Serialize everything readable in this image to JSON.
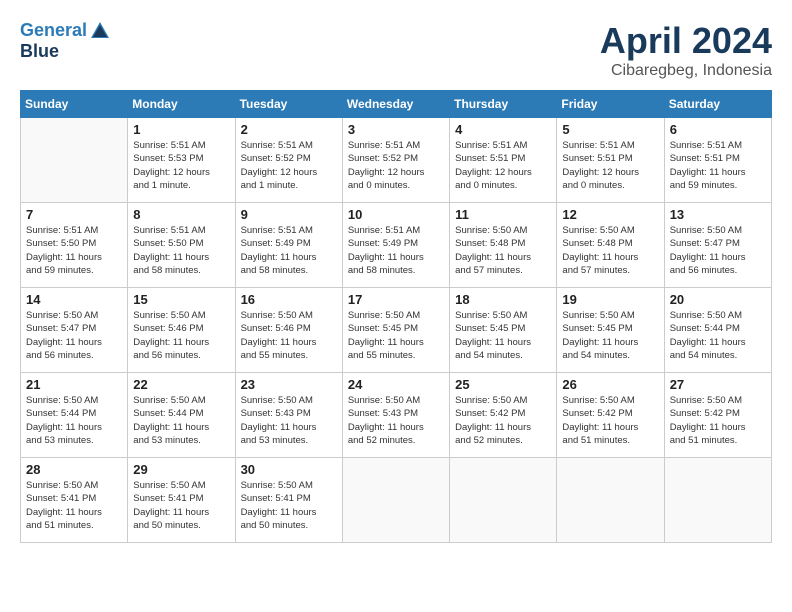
{
  "header": {
    "logo_line1": "General",
    "logo_line2": "Blue",
    "month_title": "April 2024",
    "subtitle": "Cibaregbeg, Indonesia"
  },
  "days_of_week": [
    "Sunday",
    "Monday",
    "Tuesday",
    "Wednesday",
    "Thursday",
    "Friday",
    "Saturday"
  ],
  "weeks": [
    [
      {
        "day": "",
        "info": ""
      },
      {
        "day": "1",
        "info": "Sunrise: 5:51 AM\nSunset: 5:53 PM\nDaylight: 12 hours\nand 1 minute."
      },
      {
        "day": "2",
        "info": "Sunrise: 5:51 AM\nSunset: 5:52 PM\nDaylight: 12 hours\nand 1 minute."
      },
      {
        "day": "3",
        "info": "Sunrise: 5:51 AM\nSunset: 5:52 PM\nDaylight: 12 hours\nand 0 minutes."
      },
      {
        "day": "4",
        "info": "Sunrise: 5:51 AM\nSunset: 5:51 PM\nDaylight: 12 hours\nand 0 minutes."
      },
      {
        "day": "5",
        "info": "Sunrise: 5:51 AM\nSunset: 5:51 PM\nDaylight: 12 hours\nand 0 minutes."
      },
      {
        "day": "6",
        "info": "Sunrise: 5:51 AM\nSunset: 5:51 PM\nDaylight: 11 hours\nand 59 minutes."
      }
    ],
    [
      {
        "day": "7",
        "info": "Sunrise: 5:51 AM\nSunset: 5:50 PM\nDaylight: 11 hours\nand 59 minutes."
      },
      {
        "day": "8",
        "info": "Sunrise: 5:51 AM\nSunset: 5:50 PM\nDaylight: 11 hours\nand 58 minutes."
      },
      {
        "day": "9",
        "info": "Sunrise: 5:51 AM\nSunset: 5:49 PM\nDaylight: 11 hours\nand 58 minutes."
      },
      {
        "day": "10",
        "info": "Sunrise: 5:51 AM\nSunset: 5:49 PM\nDaylight: 11 hours\nand 58 minutes."
      },
      {
        "day": "11",
        "info": "Sunrise: 5:50 AM\nSunset: 5:48 PM\nDaylight: 11 hours\nand 57 minutes."
      },
      {
        "day": "12",
        "info": "Sunrise: 5:50 AM\nSunset: 5:48 PM\nDaylight: 11 hours\nand 57 minutes."
      },
      {
        "day": "13",
        "info": "Sunrise: 5:50 AM\nSunset: 5:47 PM\nDaylight: 11 hours\nand 56 minutes."
      }
    ],
    [
      {
        "day": "14",
        "info": "Sunrise: 5:50 AM\nSunset: 5:47 PM\nDaylight: 11 hours\nand 56 minutes."
      },
      {
        "day": "15",
        "info": "Sunrise: 5:50 AM\nSunset: 5:46 PM\nDaylight: 11 hours\nand 56 minutes."
      },
      {
        "day": "16",
        "info": "Sunrise: 5:50 AM\nSunset: 5:46 PM\nDaylight: 11 hours\nand 55 minutes."
      },
      {
        "day": "17",
        "info": "Sunrise: 5:50 AM\nSunset: 5:45 PM\nDaylight: 11 hours\nand 55 minutes."
      },
      {
        "day": "18",
        "info": "Sunrise: 5:50 AM\nSunset: 5:45 PM\nDaylight: 11 hours\nand 54 minutes."
      },
      {
        "day": "19",
        "info": "Sunrise: 5:50 AM\nSunset: 5:45 PM\nDaylight: 11 hours\nand 54 minutes."
      },
      {
        "day": "20",
        "info": "Sunrise: 5:50 AM\nSunset: 5:44 PM\nDaylight: 11 hours\nand 54 minutes."
      }
    ],
    [
      {
        "day": "21",
        "info": "Sunrise: 5:50 AM\nSunset: 5:44 PM\nDaylight: 11 hours\nand 53 minutes."
      },
      {
        "day": "22",
        "info": "Sunrise: 5:50 AM\nSunset: 5:44 PM\nDaylight: 11 hours\nand 53 minutes."
      },
      {
        "day": "23",
        "info": "Sunrise: 5:50 AM\nSunset: 5:43 PM\nDaylight: 11 hours\nand 53 minutes."
      },
      {
        "day": "24",
        "info": "Sunrise: 5:50 AM\nSunset: 5:43 PM\nDaylight: 11 hours\nand 52 minutes."
      },
      {
        "day": "25",
        "info": "Sunrise: 5:50 AM\nSunset: 5:42 PM\nDaylight: 11 hours\nand 52 minutes."
      },
      {
        "day": "26",
        "info": "Sunrise: 5:50 AM\nSunset: 5:42 PM\nDaylight: 11 hours\nand 51 minutes."
      },
      {
        "day": "27",
        "info": "Sunrise: 5:50 AM\nSunset: 5:42 PM\nDaylight: 11 hours\nand 51 minutes."
      }
    ],
    [
      {
        "day": "28",
        "info": "Sunrise: 5:50 AM\nSunset: 5:41 PM\nDaylight: 11 hours\nand 51 minutes."
      },
      {
        "day": "29",
        "info": "Sunrise: 5:50 AM\nSunset: 5:41 PM\nDaylight: 11 hours\nand 50 minutes."
      },
      {
        "day": "30",
        "info": "Sunrise: 5:50 AM\nSunset: 5:41 PM\nDaylight: 11 hours\nand 50 minutes."
      },
      {
        "day": "",
        "info": ""
      },
      {
        "day": "",
        "info": ""
      },
      {
        "day": "",
        "info": ""
      },
      {
        "day": "",
        "info": ""
      }
    ]
  ]
}
